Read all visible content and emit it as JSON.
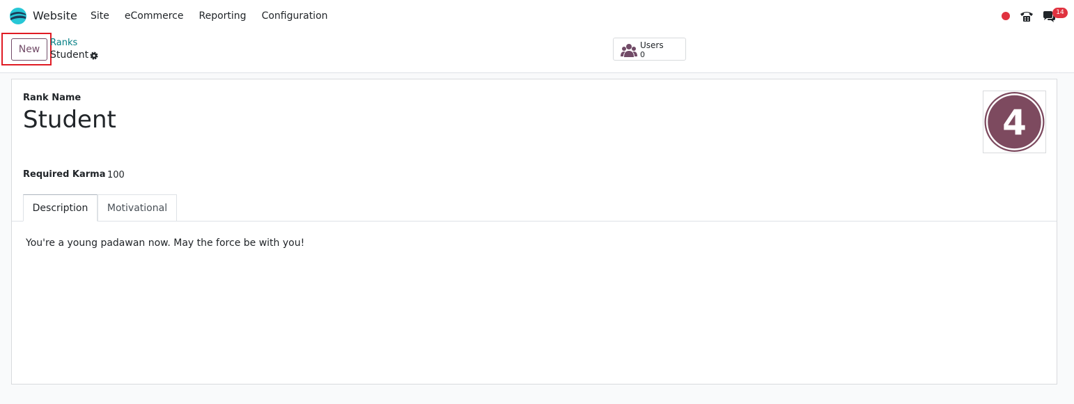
{
  "navbar": {
    "app_name": "Website",
    "menu": [
      "Site",
      "eCommerce",
      "Reporting",
      "Configuration"
    ],
    "chat_badge": "14"
  },
  "control_panel": {
    "new_label": "New",
    "breadcrumb_parent": "Ranks",
    "breadcrumb_current": "Student",
    "smart_button": {
      "label": "Users",
      "value": "0"
    }
  },
  "form": {
    "rank_name_label": "Rank Name",
    "rank_name": "Student",
    "rank_image_glyph": "4",
    "required_karma_label": "Required Karma",
    "required_karma": "100",
    "tabs": [
      "Description",
      "Motivational"
    ],
    "active_tab": "Description",
    "description_text": "You're a young padawan now. May the force be with you!"
  },
  "colors": {
    "brand": "#714b67",
    "link": "#017e84",
    "badge": "#e0323f",
    "highlight": "#e01b24"
  }
}
